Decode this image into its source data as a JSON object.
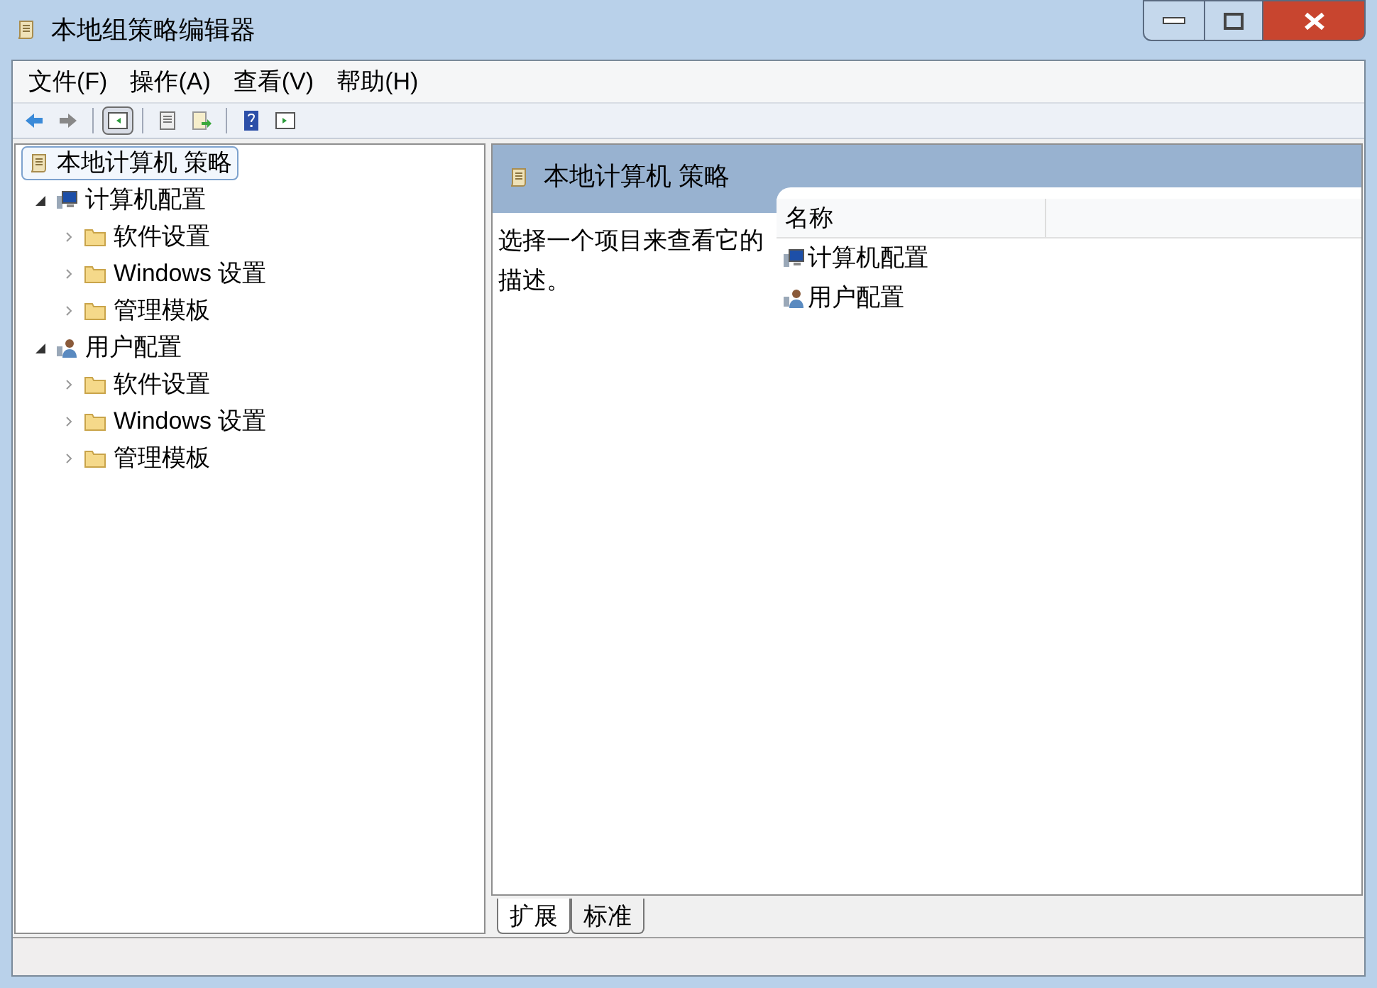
{
  "window": {
    "title": "本地组策略编辑器"
  },
  "menu": [
    "文件(F)",
    "操作(A)",
    "查看(V)",
    "帮助(H)"
  ],
  "toolbar": [
    {
      "kind": "back",
      "selected": false
    },
    {
      "kind": "forward",
      "selected": false
    },
    {
      "kind": "sep"
    },
    {
      "kind": "tree",
      "selected": true
    },
    {
      "kind": "sep"
    },
    {
      "kind": "properties",
      "selected": false
    },
    {
      "kind": "export",
      "selected": false
    },
    {
      "kind": "sep"
    },
    {
      "kind": "help",
      "selected": false
    },
    {
      "kind": "pane",
      "selected": false
    }
  ],
  "tree": [
    {
      "label": "本地计算机 策略",
      "kind": "scroll",
      "selected": true,
      "children": [
        {
          "label": "计算机配置",
          "kind": "computer",
          "selected": false,
          "expanded": true,
          "children": [
            {
              "label": "软件设置",
              "kind": "folder",
              "selected": false,
              "expanded": false
            },
            {
              "label": "Windows 设置",
              "kind": "folder",
              "selected": false,
              "expanded": false
            },
            {
              "label": "管理模板",
              "kind": "folder",
              "selected": false,
              "expanded": false
            }
          ]
        },
        {
          "label": "用户配置",
          "kind": "user",
          "selected": false,
          "expanded": true,
          "children": [
            {
              "label": "软件设置",
              "kind": "folder",
              "selected": false,
              "expanded": false
            },
            {
              "label": "Windows 设置",
              "kind": "folder",
              "selected": false,
              "expanded": false
            },
            {
              "label": "管理模板",
              "kind": "folder",
              "selected": false,
              "expanded": false
            }
          ]
        }
      ]
    }
  ],
  "details": {
    "title": "本地计算机 策略",
    "description": "选择一个项目来查看它的描述。",
    "columns": [
      "名称"
    ],
    "rows": [
      {
        "name": "计算机配置",
        "kind": "computer"
      },
      {
        "name": "用户配置",
        "kind": "user"
      }
    ]
  },
  "tabs": [
    {
      "label": "扩展",
      "selected": true
    },
    {
      "label": "标准",
      "selected": false
    }
  ]
}
